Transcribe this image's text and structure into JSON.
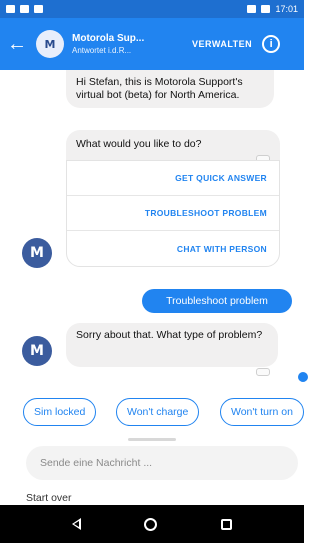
{
  "status_bar": {
    "time": "17:01"
  },
  "header": {
    "title": "Motorola Sup...",
    "subtitle": "Antwortet i.d.R...",
    "manage_label": "VERWALTEN",
    "info_label": "i",
    "back_label": "←"
  },
  "messages": {
    "bot_intro": "Hi Stefan, this is Motorola Support's virtual bot (beta) for North America.",
    "bot_question": "What would you like to do?",
    "options": [
      "GET QUICK ANSWER",
      "TROUBLESHOOT PROBLEM",
      "CHAT WITH PERSON"
    ],
    "user_reply": "Troubleshoot problem",
    "bot_followup": "Sorry about that. What type of problem?"
  },
  "quick_replies": [
    "Sim locked",
    "Won't charge",
    "Won't turn on"
  ],
  "composer": {
    "placeholder": "Sende eine Nachricht ..."
  },
  "start_over": "Start over",
  "avatar_letter": "M",
  "colors": {
    "accent": "#2184f0",
    "status_bar": "#1e6fd0",
    "bubble_in": "#f1f0f0"
  }
}
